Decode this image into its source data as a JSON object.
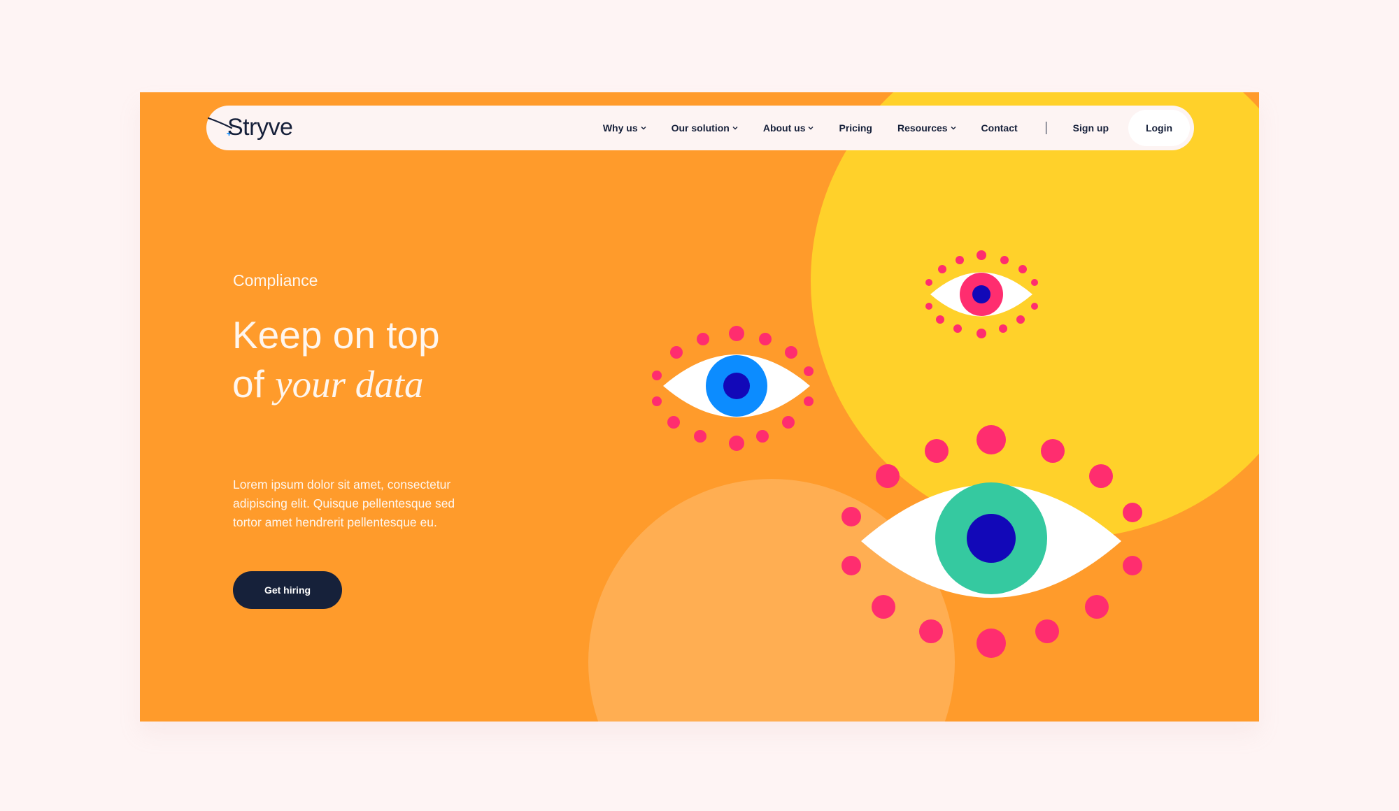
{
  "brand": {
    "name": "Stryve"
  },
  "nav": {
    "items": [
      {
        "label": "Why us",
        "dropdown": true
      },
      {
        "label": "Our solution",
        "dropdown": true
      },
      {
        "label": "About us",
        "dropdown": true
      },
      {
        "label": "Pricing",
        "dropdown": false
      },
      {
        "label": "Resources",
        "dropdown": true
      },
      {
        "label": "Contact",
        "dropdown": false
      }
    ],
    "signup_label": "Sign up",
    "login_label": "Login"
  },
  "hero": {
    "eyebrow": "Compliance",
    "headline_line1": "Keep on top",
    "headline_line2_prefix": "of ",
    "headline_line2_emphasis": "your data",
    "body": "Lorem ipsum dolor sit amet, consectetur adipiscing elit. Quisque pellentesque sed tortor amet hendrerit pellentesque eu.",
    "cta_label": "Get hiring"
  },
  "colors": {
    "page_background": "#fef4f4",
    "hero_background": "#ff9b2b",
    "yellow_circle": "#ffd12a",
    "peach_circle": "#ffae52",
    "navy": "#16213a",
    "pink": "#ff2d6f",
    "blue_iris": "#0c8cff",
    "pink_iris": "#ff2d6f",
    "green_iris": "#35c9a0",
    "pupil": "#1208b8"
  },
  "icons": [
    "chevron-down-icon",
    "stryve-logo",
    "eye-illustration"
  ]
}
